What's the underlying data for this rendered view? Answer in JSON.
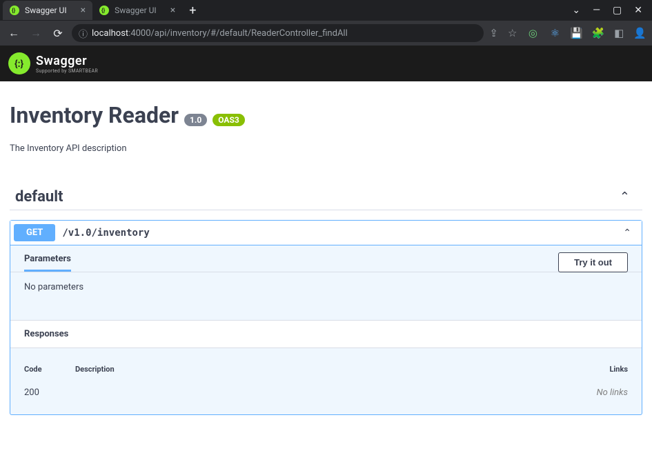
{
  "browser": {
    "tabs": [
      {
        "title": "Swagger UI",
        "active": true
      },
      {
        "title": "Swagger UI",
        "active": false
      }
    ],
    "url": {
      "host": "localhost",
      "rest": ":4000/api/inventory/#/default/ReaderController_findAll"
    },
    "window_controls": {
      "min": "—",
      "max": "▢",
      "close": "✕"
    }
  },
  "swagger": {
    "brand": "Swagger",
    "subbrand": "Supported by SMARTBEAR"
  },
  "api": {
    "title": "Inventory Reader",
    "version": "1.0",
    "oas": "OAS3",
    "description": "The Inventory API description"
  },
  "tag": {
    "name": "default"
  },
  "operation": {
    "method": "GET",
    "path": "/v1.0/inventory",
    "parameters_label": "Parameters",
    "try_label": "Try it out",
    "no_params": "No parameters",
    "responses_label": "Responses",
    "table": {
      "code_header": "Code",
      "desc_header": "Description",
      "links_header": "Links",
      "rows": [
        {
          "code": "200",
          "desc": "",
          "links": "No links"
        }
      ]
    }
  }
}
